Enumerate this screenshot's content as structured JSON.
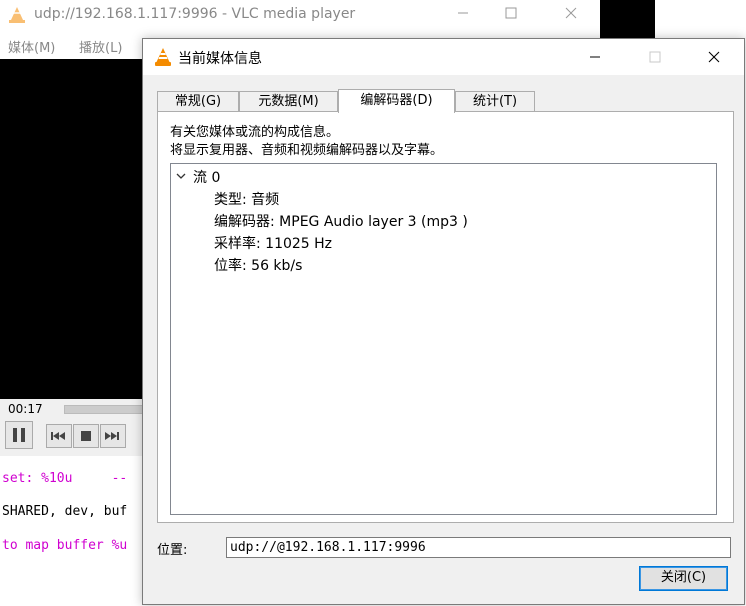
{
  "background_window": {
    "title": "udp://192.168.1.117:9996 - VLC media player",
    "menus": [
      "媒体(M)",
      "播放(L)"
    ],
    "time": "00:17",
    "terminal_lines": [
      {
        "text": "set: %10u     --"
      },
      {
        "text": "SHARED, dev, buf"
      },
      {
        "text": "to map buffer %u"
      }
    ]
  },
  "dialog": {
    "title": "当前媒体信息",
    "tabs": [
      {
        "label": "常规(G)"
      },
      {
        "label": "元数据(M)"
      },
      {
        "label": "编解码器(D)",
        "active": true
      },
      {
        "label": "统计(T)"
      }
    ],
    "description": [
      "有关您媒体或流的构成信息。",
      "将显示复用器、音频和视频编解码器以及字幕。"
    ],
    "tree": {
      "root": "流 0",
      "items": [
        "类型: 音频",
        "编解码器: MPEG Audio layer 3 (mp3 )",
        "采样率: 11025 Hz",
        "位率: 56 kb/s"
      ]
    },
    "location_label": "位置:",
    "location_value": "udp://@192.168.1.117:9996",
    "close_label": "关闭(C)"
  },
  "colors": {
    "vlc_orange": "#f48b00",
    "terminal_magenta": "#d000d0",
    "focus_blue": "#0078d7"
  },
  "icons": [
    "vlc-cone-icon",
    "minimize-icon",
    "maximize-icon",
    "close-icon",
    "chevron-down-icon",
    "pause-icon",
    "previous-icon",
    "stop-icon",
    "next-icon"
  ]
}
